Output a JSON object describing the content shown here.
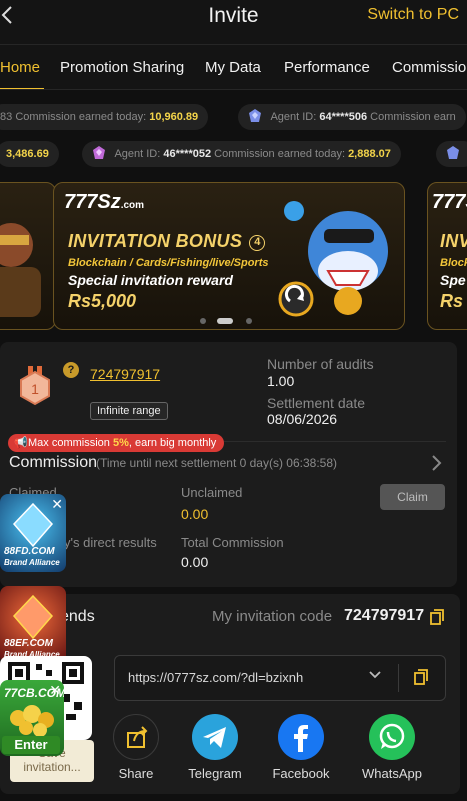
{
  "header": {
    "back_icon": "chevron-left-icon",
    "title": "Invite",
    "switch_pc": "Switch to PC"
  },
  "tabs": [
    {
      "label": "Home",
      "active": true
    },
    {
      "label": "Promotion Sharing",
      "active": false
    },
    {
      "label": "My Data",
      "active": false
    },
    {
      "label": "Performance",
      "active": false
    },
    {
      "label": "Commission",
      "active": false
    }
  ],
  "ticker_row1": [
    {
      "prefix": "83",
      "label": "Commission earned today:",
      "value": "10,960.89"
    },
    {
      "agent_label": "Agent ID:",
      "agent_id": "64****506",
      "label": "Commission earn"
    }
  ],
  "ticker_row2": [
    {
      "value": "3,486.69"
    },
    {
      "agent_label": "Agent ID:",
      "agent_id": "46****052",
      "label": "Commission earned today:",
      "value": "2,888.07"
    }
  ],
  "banner": {
    "brand": "777Sz",
    "brand_suffix": ".com",
    "title": "INVITATION BONUS",
    "title_number": "4",
    "subtitle": "Blockchain / Cards/Fishing/live/Sports",
    "special": "Special invitation reward",
    "reward": "Rs5,000",
    "right_partial_title": "INV",
    "right_partial_sub": "Block",
    "right_partial_special": "Spe",
    "right_partial_reward": "Rs"
  },
  "agent": {
    "level": "1",
    "code": "724797917",
    "range_badge": "Infinite range",
    "audits_label": "Number of audits",
    "audits_value": "1.00",
    "settlement_label": "Settlement date",
    "settlement_value": "08/06/2026"
  },
  "promo": {
    "text_before": "Max commission ",
    "highlight": "5%",
    "text_after": ", earn big monthly"
  },
  "commission": {
    "title": "Commission",
    "subtitle": "(Time until next settlement  0 day(s) 06:38:58)",
    "claimed_label": "Claimed",
    "unclaimed_label": "Unclaimed",
    "unclaimed_value": "0.00",
    "claim_button": "Claim",
    "direct_label": "y's direct results",
    "total_label": "Total Commission",
    "total_value": "0.00"
  },
  "friends": {
    "title_partial": "ends",
    "code_label": "My invitation code",
    "code_value": "724797917",
    "link": "https://0777sz.com/?dl=bzixnh",
    "save_label": "Save invitation..."
  },
  "share": [
    {
      "label": "Share",
      "icon": "share-icon",
      "color": "#1c1c1c"
    },
    {
      "label": "Telegram",
      "icon": "telegram-icon",
      "color": "#2aa3dc"
    },
    {
      "label": "Facebook",
      "icon": "facebook-icon",
      "color": "#1877f2"
    },
    {
      "label": "WhatsApp",
      "icon": "whatsapp-icon",
      "color": "#25c15a"
    }
  ],
  "floats": [
    {
      "label": "88FD.COM",
      "sub": "Brand Alliance"
    },
    {
      "label": "88EF.COM",
      "sub": "Brand Alliance"
    },
    {
      "label": "77CB.COM",
      "enter": "Enter"
    }
  ],
  "colors": {
    "accent": "#f0c030",
    "background": "#101010",
    "card": "#1c1c1c",
    "promo_red": "#d93a35"
  }
}
